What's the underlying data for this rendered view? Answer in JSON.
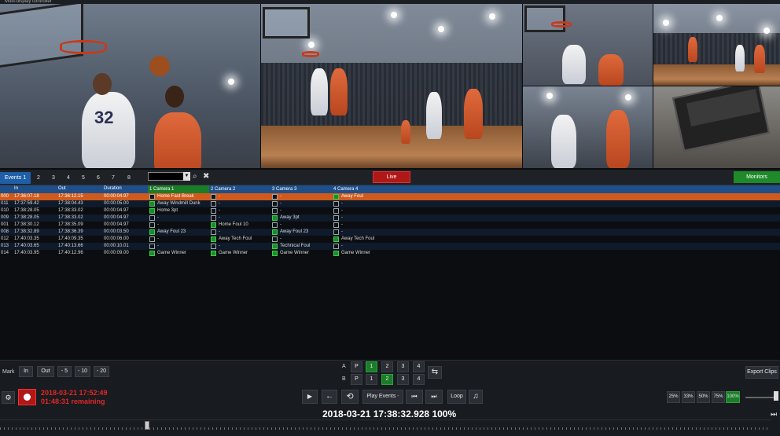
{
  "window": {
    "title": "Multi-display controller"
  },
  "tabs": [
    "Events 1",
    "2",
    "3",
    "4",
    "5",
    "6",
    "7",
    "8"
  ],
  "live_label": "Live",
  "monitors_label": "Monitors",
  "columns": {
    "in": "In",
    "out": "Out",
    "duration": "Duration",
    "cam1": "1 Camera 1",
    "cam2": "2 Camera 2",
    "cam3": "3 Camera 3",
    "cam4": "4 Camera 4"
  },
  "rows": [
    {
      "id": "000",
      "in": "17:36:07.18",
      "out": "17:36:12.15",
      "dur": "00:00:04.97",
      "c1": "Home Fast Break",
      "c2": "-",
      "c3": "-",
      "c4": "Away Foul",
      "on": [
        0,
        0,
        0,
        1
      ],
      "hl": true
    },
    {
      "id": "011",
      "in": "17:37:59.42",
      "out": "17:38:04.43",
      "dur": "00:00:05.00",
      "c1": "Away Windmill Dunk",
      "c2": "-",
      "c3": "-",
      "c4": "-",
      "on": [
        1,
        0,
        0,
        0
      ]
    },
    {
      "id": "010",
      "in": "17:38:28.05",
      "out": "17:38:33.02",
      "dur": "00:00:04.97",
      "c1": "Home 3pt",
      "c2": "-",
      "c3": "-",
      "c4": "-",
      "on": [
        1,
        0,
        0,
        0
      ]
    },
    {
      "id": "009",
      "in": "17:38:28.05",
      "out": "17:38:33.02",
      "dur": "00:00:04.97",
      "c1": "-",
      "c2": "-",
      "c3": "Away 3pt",
      "c4": "-",
      "on": [
        0,
        0,
        1,
        0
      ]
    },
    {
      "id": "001",
      "in": "17:38:30.12",
      "out": "17:38:35.09",
      "dur": "00:00:04.97",
      "c1": "-",
      "c2": "Home Foul 10",
      "c3": "-",
      "c4": "-",
      "on": [
        0,
        1,
        0,
        0
      ]
    },
    {
      "id": "008",
      "in": "17:38:32.89",
      "out": "17:38:36.39",
      "dur": "00:00:03.50",
      "c1": "Away Foul 23",
      "c2": "-",
      "c3": "Away Foul 23",
      "c4": "-",
      "on": [
        1,
        0,
        1,
        0
      ]
    },
    {
      "id": "012",
      "in": "17:40:03.35",
      "out": "17:40:09.35",
      "dur": "00:00:06.00",
      "c1": "-",
      "c2": "Away Tech Foul",
      "c3": "-",
      "c4": "Away Tech Foul",
      "on": [
        0,
        1,
        0,
        1
      ]
    },
    {
      "id": "013",
      "in": "17:40:03.65",
      "out": "17:40:13.66",
      "dur": "00:00:10.01",
      "c1": "-",
      "c2": "-",
      "c3": "Technical Foul",
      "c4": "-",
      "on": [
        0,
        0,
        1,
        0
      ]
    },
    {
      "id": "014",
      "in": "17:40:03.95",
      "out": "17:40:12.96",
      "dur": "00:00:09.00",
      "c1": "Game Winner",
      "c2": "Game Winner",
      "c3": "Game Winner",
      "c4": "Game Winner",
      "on": [
        1,
        1,
        1,
        1
      ]
    }
  ],
  "mark": {
    "label": "Mark",
    "in": "In",
    "out": "Out",
    "m5": "- 5",
    "m10": "- 10",
    "m20": "- 20"
  },
  "rowA": {
    "label": "A",
    "p": "P",
    "n": [
      "1",
      "2",
      "3",
      "4"
    ],
    "active": 0
  },
  "rowB": {
    "label": "B",
    "p": "P",
    "n": [
      "1",
      "2",
      "3",
      "4"
    ],
    "active": 1
  },
  "export_label": "Export Clips",
  "record": {
    "date": "2018-03-21 17:52:49",
    "remaining": "01:48:31 remaining"
  },
  "transport": {
    "play_events": "Play Events",
    "loop": "Loop"
  },
  "timecode": "2018-03-21 17:38:32.928   100%",
  "zoom": [
    "25%",
    "33%",
    "50%",
    "75%",
    "100%"
  ],
  "zoom_active": "100%"
}
